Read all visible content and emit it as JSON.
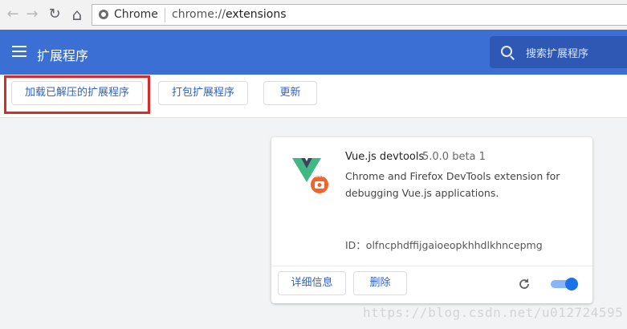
{
  "browser": {
    "back_icon": "←",
    "forward_icon": "→",
    "reload_icon": "↻",
    "home_icon": "⌂",
    "chip_label": "Chrome",
    "url_scheme": "chrome://",
    "url_path": "extensions"
  },
  "header": {
    "title": "扩展程序",
    "search_placeholder": "搜索扩展程序"
  },
  "toolbar": {
    "load_unpacked": "加载已解压的扩展程序",
    "pack_extension": "打包扩展程序",
    "update": "更新"
  },
  "extension": {
    "name": "Vue.js devtools",
    "version": "5.0.0 beta 1",
    "description": "Chrome and Firefox DevTools extension for debugging Vue.js applications.",
    "id_label": "ID：olfncphdffijgaioeopkhhdlkhncepmg",
    "logo_badge": "beta",
    "details_button": "详细信息",
    "remove_button": "删除",
    "enabled": true
  },
  "watermark": "https://blog.csdn.net/u012724595",
  "colors": {
    "header": "#3b6fd3",
    "accent": "#2f63c7",
    "highlight": "#d92a2a",
    "vue_green": "#41b883",
    "vue_dark": "#34495e",
    "badge_orange": "#f0652b"
  }
}
